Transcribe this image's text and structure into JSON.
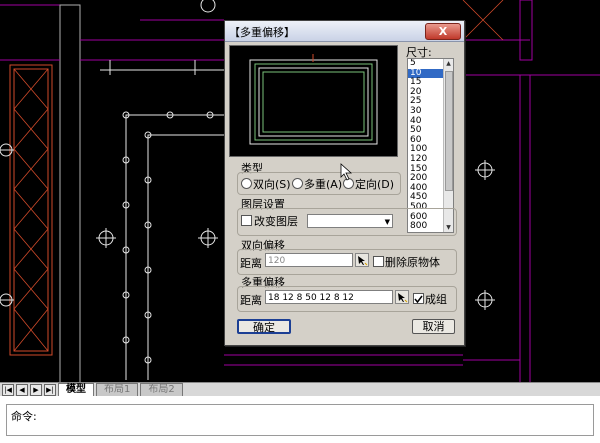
{
  "dialog": {
    "title": "【多重偏移】",
    "close_label": "X",
    "size_label": "尺寸:",
    "sizes": [
      "5",
      "10",
      "15",
      "20",
      "25",
      "30",
      "40",
      "50",
      "60",
      "100",
      "120",
      "150",
      "200",
      "400",
      "450",
      "500",
      "600",
      "800"
    ],
    "selected_size": "10",
    "type_group": {
      "label": "类型",
      "options": [
        "双向(S)",
        "多重(A)",
        "定向(D)"
      ]
    },
    "layer_group": {
      "label": "图层设置",
      "change_layer_label": "改变图层",
      "layer_value": ""
    },
    "bidirectional_group": {
      "label": "双向偏移",
      "distance_label": "距离",
      "distance_value": "120",
      "delete_source_label": "删除原物体"
    },
    "multi_group": {
      "label": "多重偏移",
      "distance_label": "距离",
      "distance_value": "18 12 8 50 12 8 12",
      "group_label": "成组",
      "group_checked": true
    },
    "ok_label": "确定",
    "cancel_label": "取消"
  },
  "layout_tabs": {
    "nav_buttons": [
      "|◀",
      "◀",
      "▶",
      "▶|"
    ],
    "tabs": [
      "模型",
      "布局1",
      "布局2"
    ],
    "active": "模型"
  },
  "command_line": {
    "prompt": "命令:"
  },
  "colors": {
    "canvas_bg": "#000000",
    "wall_lines": "#a000a0",
    "furniture": "#d04a2a",
    "white_lines": "#e6e6e6",
    "selection": "#316ac5"
  }
}
